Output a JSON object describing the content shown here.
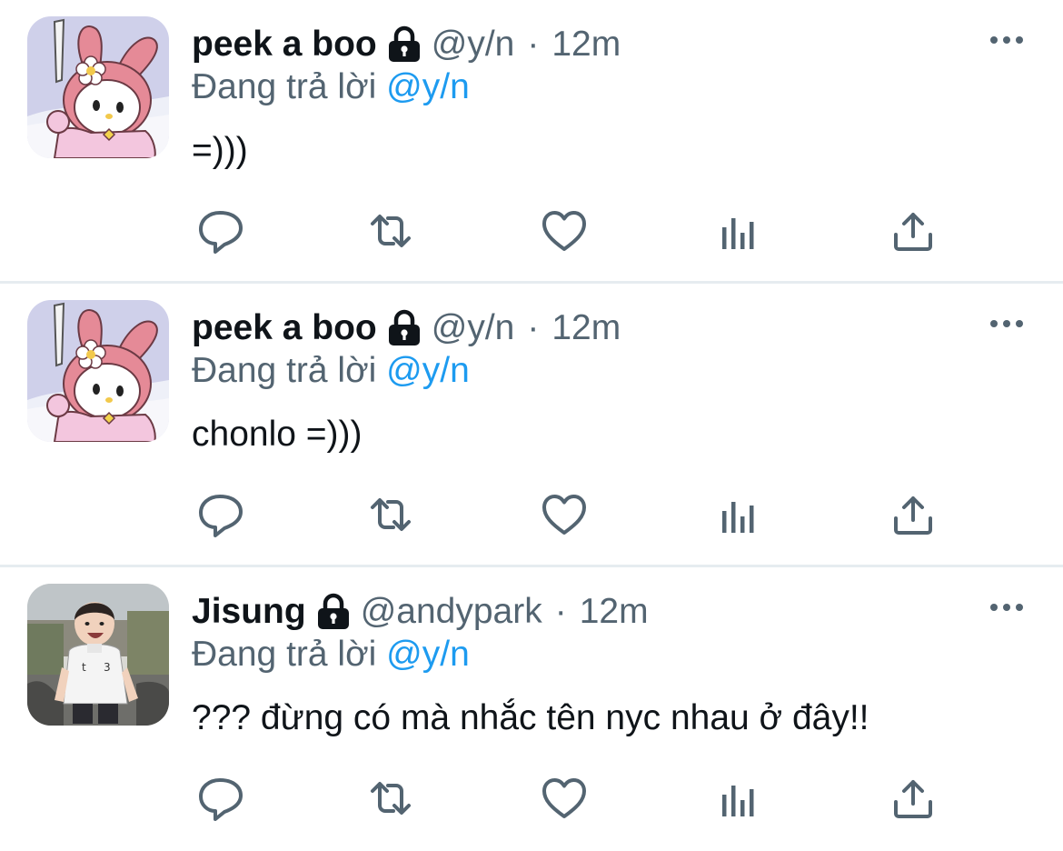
{
  "colors": {
    "mention": "#1d9bf0",
    "secondary": "#536471",
    "divider": "#e6ecf0",
    "text": "#0f1419"
  },
  "icons": {
    "lock": "lock-icon",
    "more": "more-icon",
    "reply": "reply-icon",
    "retweet": "retweet-icon",
    "like": "heart-icon",
    "analytics": "analytics-icon",
    "share": "share-icon"
  },
  "tweets": [
    {
      "name": "peek a boo",
      "handle": "@y/n",
      "separator": "·",
      "time": "12m",
      "reply_prefix": "Đang trả lời",
      "reply_to": "@y/n",
      "text": "=)))"
    },
    {
      "name": "peek a boo",
      "handle": "@y/n",
      "separator": "·",
      "time": "12m",
      "reply_prefix": "Đang trả lời",
      "reply_to": "@y/n",
      "text": "chonlo =)))"
    },
    {
      "name": "Jisung",
      "handle": "@andypark",
      "separator": "·",
      "time": "12m",
      "reply_prefix": "Đang trả lời",
      "reply_to": "@y/n",
      "text": "??? đừng có mà nhắc tên nyc nhau ở đây!!"
    }
  ]
}
